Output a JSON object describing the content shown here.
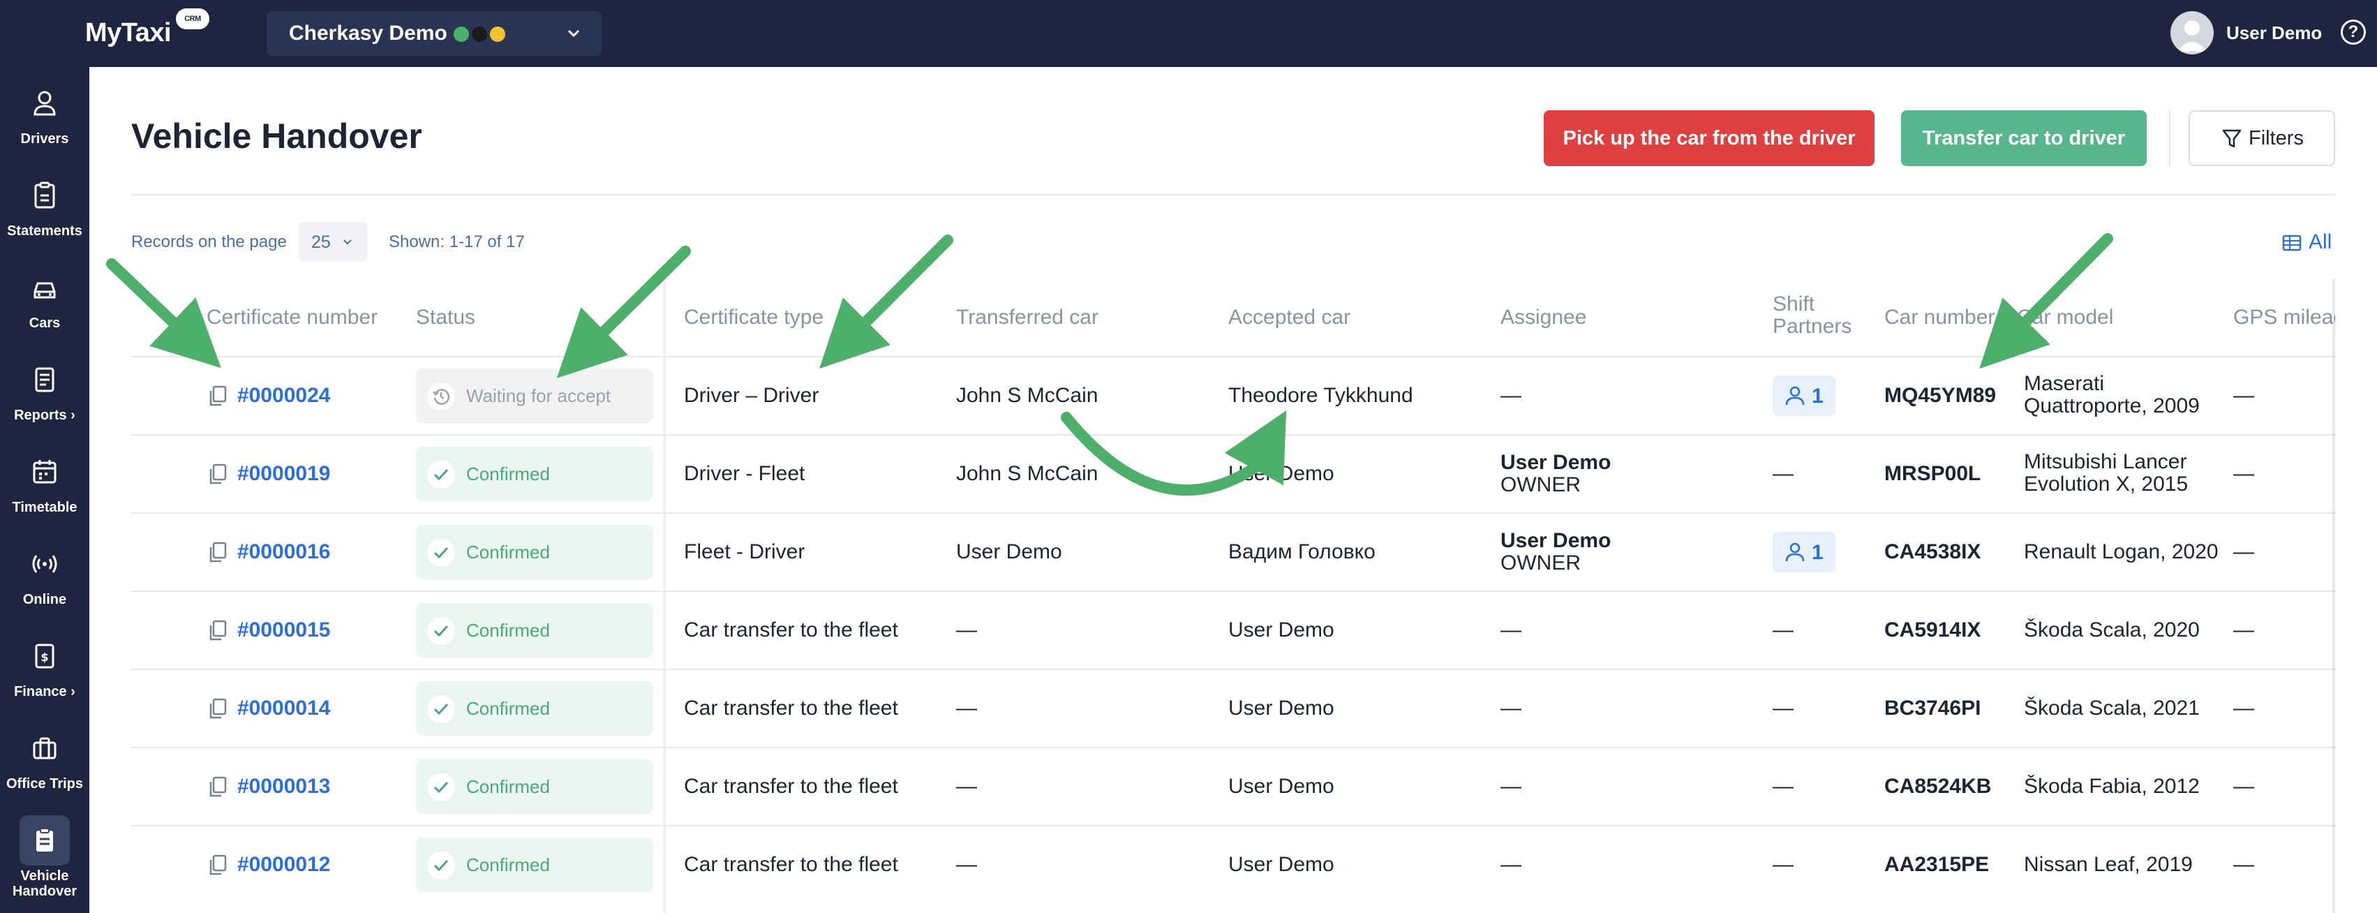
{
  "app": {
    "logo": "MyTaxi",
    "logo_badge": "CRM"
  },
  "header": {
    "fleet_name": "Cherkasy Demo",
    "user_name": "User Demo",
    "help": "?"
  },
  "sidebar": {
    "items": [
      {
        "label": "Drivers",
        "icon": "person-icon"
      },
      {
        "label": "Statements",
        "icon": "clipboard-icon"
      },
      {
        "label": "Cars",
        "icon": "car-icon"
      },
      {
        "label": "Reports ›",
        "icon": "report-icon"
      },
      {
        "label": "Timetable",
        "icon": "calendar-icon"
      },
      {
        "label": "Online",
        "icon": "broadcast-icon"
      },
      {
        "label": "Finance ›",
        "icon": "finance-icon"
      },
      {
        "label": "Office Trips",
        "icon": "briefcase-icon"
      },
      {
        "label": "Vehicle Handover",
        "icon": "handover-icon",
        "active": true
      }
    ]
  },
  "page": {
    "title": "Vehicle Handover",
    "pickup_button": "Pick up the car from the driver",
    "transfer_button": "Transfer car to driver",
    "filters_button": "Filters",
    "records_label": "Records on the page",
    "records_value": "25",
    "shown": "Shown: 1-17 of 17",
    "columns_toggle": "All"
  },
  "table": {
    "columns": [
      "Certificate number",
      "Status",
      "Certificate type",
      "Transferred car",
      "Accepted car",
      "Assignee",
      "Shift Partners",
      "Car number",
      "Car model",
      "GPS mileag"
    ],
    "rows": [
      {
        "cert": "#0000024",
        "status": "Waiting for accept",
        "status_kind": "wait",
        "type": "Driver – Driver",
        "transferred": "John S McCain",
        "accepted": "Theodore Tykkhund",
        "assignee": "—",
        "assignee_role": "",
        "partners": "1",
        "car_number": "MQ45YM89",
        "car_model": "Maserati Quattroporte, 2009",
        "gps": "—"
      },
      {
        "cert": "#0000019",
        "status": "Confirmed",
        "status_kind": "ok",
        "type": "Driver - Fleet",
        "transferred": "John S McCain",
        "accepted": "User Demo",
        "assignee": "User Demo",
        "assignee_role": "OWNER",
        "partners": "—",
        "car_number": "MRSP00L",
        "car_model": "Mitsubishi Lancer Evolution X, 2015",
        "gps": "—"
      },
      {
        "cert": "#0000016",
        "status": "Confirmed",
        "status_kind": "ok",
        "type": "Fleet - Driver",
        "transferred": "User Demo",
        "accepted": "Вадим Головко",
        "assignee": "User Demo",
        "assignee_role": "OWNER",
        "partners": "1",
        "car_number": "CA4538IX",
        "car_model": "Renault Logan, 2020",
        "gps": "—"
      },
      {
        "cert": "#0000015",
        "status": "Confirmed",
        "status_kind": "ok",
        "type": "Car transfer to the fleet",
        "transferred": "—",
        "accepted": "User Demo",
        "assignee": "—",
        "assignee_role": "",
        "partners": "—",
        "car_number": "CA5914IX",
        "car_model": "Škoda Scala, 2020",
        "gps": "—"
      },
      {
        "cert": "#0000014",
        "status": "Confirmed",
        "status_kind": "ok",
        "type": "Car transfer to the fleet",
        "transferred": "—",
        "accepted": "User Demo",
        "assignee": "—",
        "assignee_role": "",
        "partners": "—",
        "car_number": "BC3746PI",
        "car_model": "Škoda Scala, 2021",
        "gps": "—"
      },
      {
        "cert": "#0000013",
        "status": "Confirmed",
        "status_kind": "ok",
        "type": "Car transfer to the fleet",
        "transferred": "—",
        "accepted": "User Demo",
        "assignee": "—",
        "assignee_role": "",
        "partners": "—",
        "car_number": "CA8524KB",
        "car_model": "Škoda Fabia, 2012",
        "gps": "—"
      },
      {
        "cert": "#0000012",
        "status": "Confirmed",
        "status_kind": "ok",
        "type": "Car transfer to the fleet",
        "transferred": "—",
        "accepted": "User Demo",
        "assignee": "—",
        "assignee_role": "",
        "partners": "—",
        "car_number": "AA2315PE",
        "car_model": "Nissan Leaf, 2019",
        "gps": "—"
      }
    ]
  },
  "colors": {
    "navy": "#1d2540",
    "red": "#e04040",
    "green": "#57b68e",
    "link_blue": "#2a6fdb",
    "arrow_green": "#4caf6a"
  }
}
